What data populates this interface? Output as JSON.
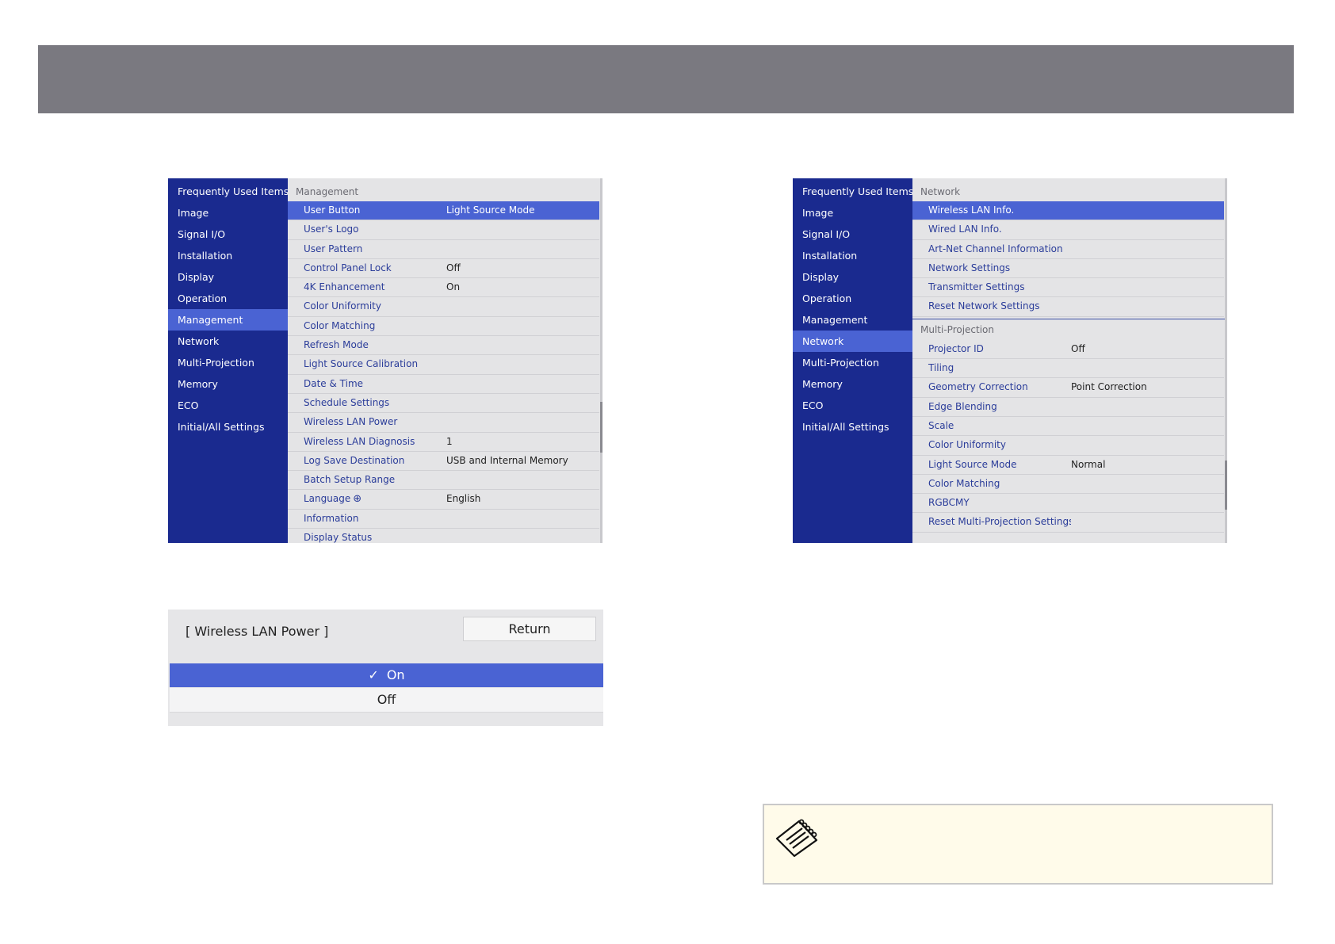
{
  "menu1": {
    "nav": [
      "Frequently Used Items",
      "Image",
      "Signal I/O",
      "Installation",
      "Display",
      "Operation",
      "Management",
      "Network",
      "Multi-Projection",
      "Memory",
      "ECO",
      "Initial/All Settings"
    ],
    "active_index": 6,
    "section": "Management",
    "rows": [
      {
        "label": "User Button",
        "value": "Light Source Mode"
      },
      {
        "label": "User's Logo",
        "value": ""
      },
      {
        "label": "User Pattern",
        "value": ""
      },
      {
        "label": "Control Panel Lock",
        "value": "Off"
      },
      {
        "label": "4K Enhancement",
        "value": "On"
      },
      {
        "label": "Color Uniformity",
        "value": ""
      },
      {
        "label": "Color Matching",
        "value": ""
      },
      {
        "label": "Refresh Mode",
        "value": ""
      },
      {
        "label": "Light Source Calibration",
        "value": ""
      },
      {
        "label": "Date & Time",
        "value": ""
      },
      {
        "label": "Schedule Settings",
        "value": ""
      },
      {
        "label": "Wireless LAN Power",
        "value": ""
      },
      {
        "label": "Wireless LAN Diagnosis",
        "value": "1"
      },
      {
        "label": "Log Save Destination",
        "value": "USB and Internal Memory"
      },
      {
        "label": "Batch Setup Range",
        "value": ""
      },
      {
        "label": "Language",
        "value": "English"
      },
      {
        "label": "Information",
        "value": ""
      },
      {
        "label": "Display Status",
        "value": ""
      }
    ]
  },
  "menu2": {
    "nav": [
      "Frequently Used Items",
      "Image",
      "Signal I/O",
      "Installation",
      "Display",
      "Operation",
      "Management",
      "Network",
      "Multi-Projection",
      "Memory",
      "ECO",
      "Initial/All Settings"
    ],
    "active_index": 7,
    "section1": "Network",
    "rows1": [
      {
        "label": "Wireless LAN Info.",
        "value": ""
      },
      {
        "label": "Wired LAN Info.",
        "value": ""
      },
      {
        "label": "Art-Net Channel Information",
        "value": ""
      },
      {
        "label": "Network Settings",
        "value": ""
      },
      {
        "label": "Transmitter Settings",
        "value": ""
      },
      {
        "label": "Reset Network Settings",
        "value": ""
      }
    ],
    "section2": "Multi-Projection",
    "rows2": [
      {
        "label": "Projector ID",
        "value": "Off"
      },
      {
        "label": "Tiling",
        "value": ""
      },
      {
        "label": "Geometry Correction",
        "value": "Point Correction"
      },
      {
        "label": "Edge Blending",
        "value": ""
      },
      {
        "label": "Scale",
        "value": ""
      },
      {
        "label": "Color Uniformity",
        "value": ""
      },
      {
        "label": "Light Source Mode",
        "value": "Normal"
      },
      {
        "label": "Color Matching",
        "value": ""
      },
      {
        "label": "RGBCMY",
        "value": ""
      },
      {
        "label": "Reset Multi-Projection Settings",
        "value": ""
      }
    ]
  },
  "dialog": {
    "title": "[ Wireless LAN Power ]",
    "return_label": "Return",
    "option_on": "On",
    "option_off": "Off"
  },
  "icons": {
    "globe": "globe-icon",
    "check": "check-icon",
    "note": "note-icon"
  },
  "colors": {
    "header_bar": "#7a7980",
    "nav_bg": "#1a2a8f",
    "highlight": "#4a63d3",
    "note_bg": "#fffbea"
  }
}
